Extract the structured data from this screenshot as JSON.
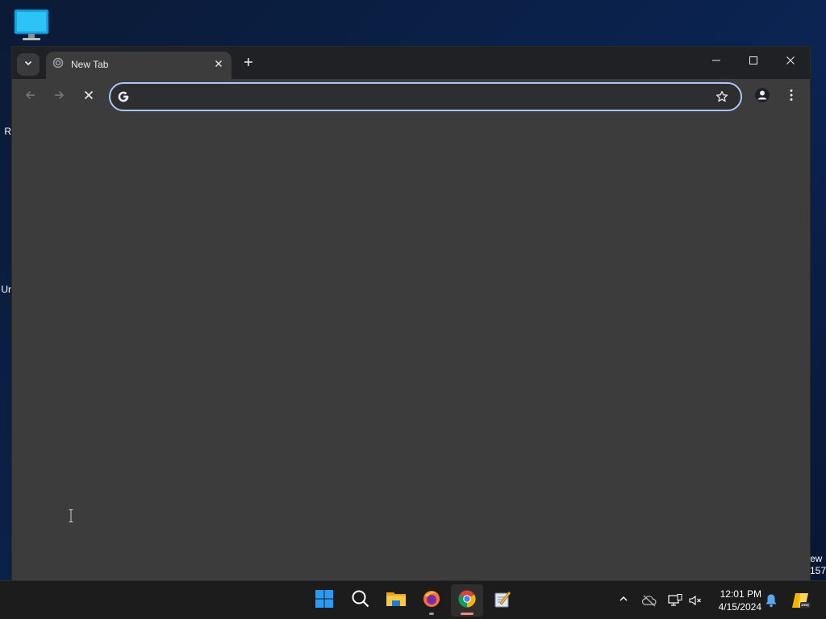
{
  "desktop": {
    "left_fragments": [
      "R",
      "Ur"
    ],
    "right_fragments": [
      "ew",
      "157"
    ]
  },
  "browser": {
    "tab": {
      "title": "New Tab"
    },
    "omnibox": {
      "value": "",
      "placeholder": ""
    }
  },
  "taskbar": {
    "apps": [
      "start",
      "search",
      "file-explorer",
      "firefox",
      "chrome",
      "notepad"
    ],
    "clock": {
      "time": "12:01 PM",
      "date": "4/15/2024"
    }
  },
  "colors": {
    "accent": "#a8c7fa",
    "titlebar": "#202124",
    "toolbar": "#3c3c3c",
    "taskbar": "#1c1c1c"
  }
}
